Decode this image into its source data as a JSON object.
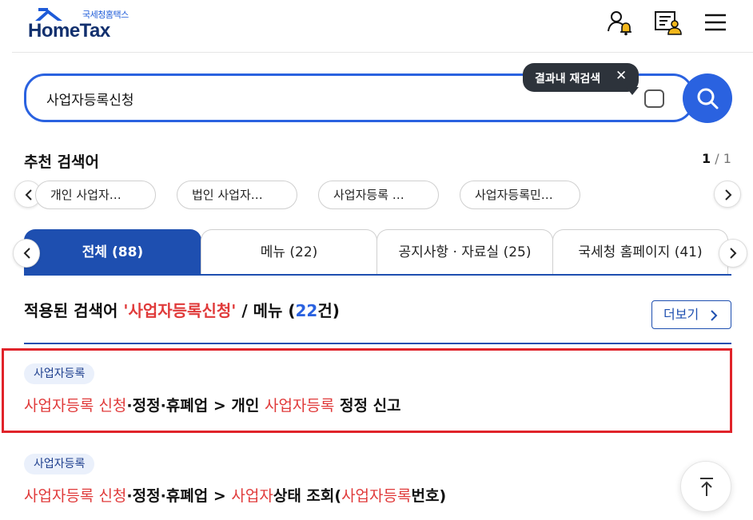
{
  "header": {
    "logo_sub": "국세청홈택스",
    "logo_main": "HomeTax",
    "icons": [
      "user-bell-icon",
      "document-user-icon",
      "menu-icon"
    ]
  },
  "search": {
    "value": "사업자등록신청",
    "tooltip": "결과내 재검색",
    "tooltip_close": "✕",
    "button_icon": "search-icon"
  },
  "recommended": {
    "title": "추천 검색어",
    "page_current": "1",
    "page_sep": " / ",
    "page_total": "1",
    "chips": [
      "개인 사업자…",
      "법인 사업자…",
      "사업자등록 …",
      "사업자등록민…"
    ]
  },
  "tabs": [
    {
      "label": "전체 (88)",
      "active": true
    },
    {
      "label": "메뉴 (22)",
      "active": false
    },
    {
      "label": "공지사항 · 자료실 (25)",
      "active": false
    },
    {
      "label": "국세청 홈페이지 (41)",
      "active": false
    }
  ],
  "applied": {
    "prefix": "적용된 검색어 ",
    "keyword": "'사업자등록신청'",
    "middle": " / 메뉴 (",
    "count": "22",
    "suffix": "건)",
    "more_label": "더보기"
  },
  "results": [
    {
      "badge": "사업자등록",
      "parts": [
        {
          "text": "사업자등록 신청",
          "hl": true
        },
        {
          "text": "·정정·휴폐업 > 개인 ",
          "hl": false
        },
        {
          "text": "사업자등록",
          "hl": true
        },
        {
          "text": " 정정 신고",
          "hl": false
        }
      ]
    },
    {
      "badge": "사업자등록",
      "parts": [
        {
          "text": "사업자등록 신청",
          "hl": true
        },
        {
          "text": "·정정·휴폐업 > ",
          "hl": false
        },
        {
          "text": "사업자",
          "hl": true
        },
        {
          "text": "상태 조회(",
          "hl": false
        },
        {
          "text": "사업자등록",
          "hl": true
        },
        {
          "text": "번호)",
          "hl": false
        }
      ]
    }
  ],
  "colors": {
    "primary": "#1e4fb0",
    "accent": "#2a62e0",
    "highlight_text": "#e03a3a",
    "selection_border": "#e0232a"
  }
}
